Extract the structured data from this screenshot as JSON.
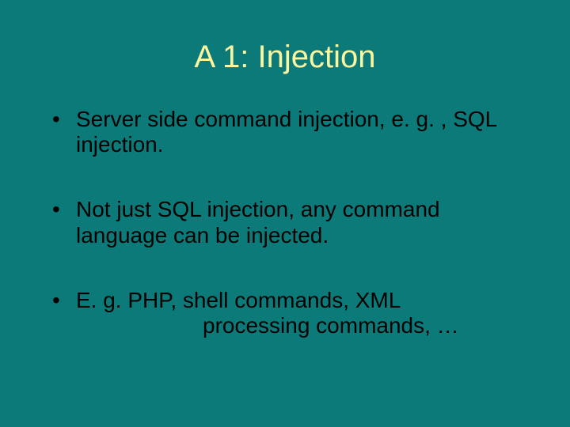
{
  "slide": {
    "title": "A 1: Injection",
    "bullets": [
      {
        "text": "Server side command injection, e. g. , SQL injection."
      },
      {
        "text": "Not just SQL injection, any command language can be injected."
      },
      {
        "text": "E. g. PHP, shell commands, XML",
        "cont": "processing commands, …"
      }
    ]
  }
}
